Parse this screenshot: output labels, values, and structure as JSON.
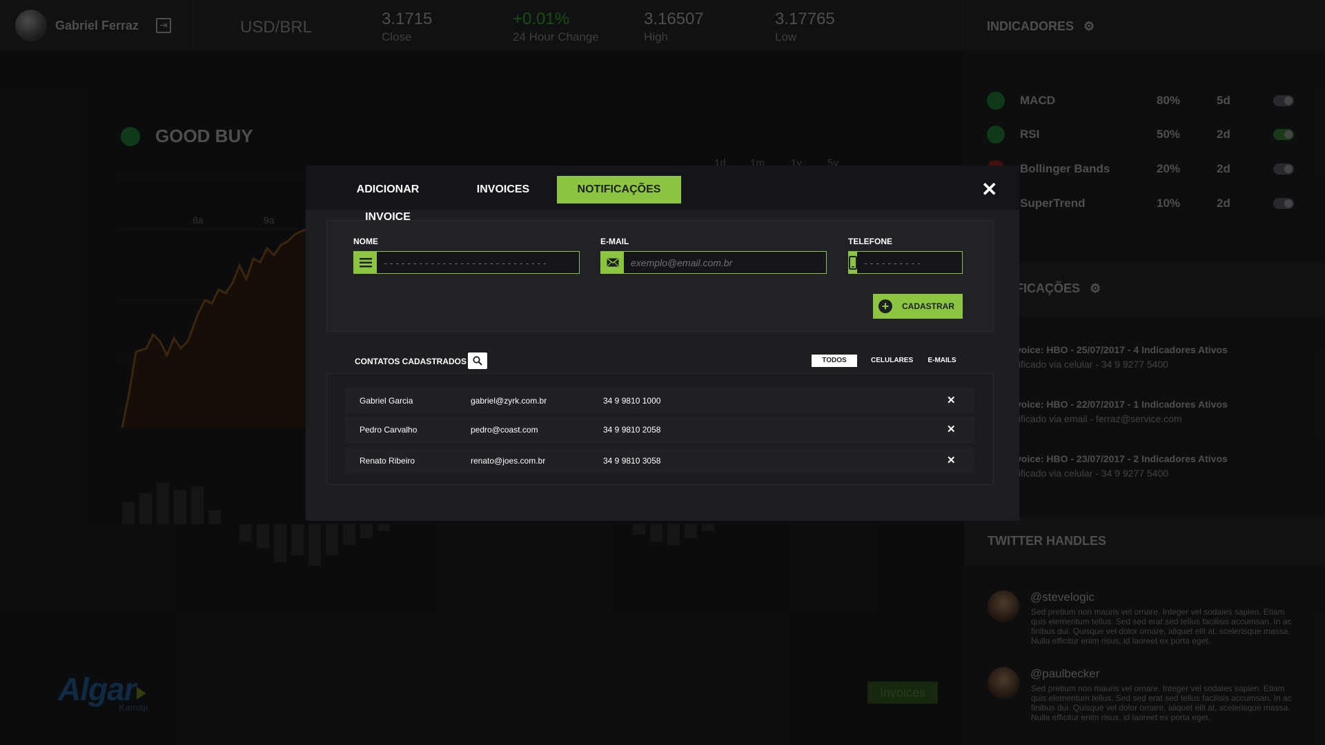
{
  "header": {
    "user_name": "Gabriel Ferraz",
    "pair": "USD/BRL",
    "stats": [
      {
        "value": "3.1715",
        "label": "Close"
      },
      {
        "value": "+0.01%",
        "label": "24 Hour Change"
      },
      {
        "value": "3.16507",
        "label": "High"
      },
      {
        "value": "3.17765",
        "label": "Low"
      }
    ],
    "indicators_title": "INDICADORES"
  },
  "indicators": [
    {
      "name": "MACD",
      "pct": "80%",
      "period": "5d",
      "on": false
    },
    {
      "name": "RSI",
      "pct": "50%",
      "period": "2d",
      "on": true
    },
    {
      "name": "Bollinger Bands",
      "pct": "20%",
      "period": "2d",
      "on": false
    },
    {
      "name": "SuperTrend",
      "pct": "10%",
      "period": "2d",
      "on": false
    }
  ],
  "notifications_panel": {
    "title": "FICAÇÕES",
    "items": [
      {
        "title": "voice: HBO - 25/07/2017 - 4 Indicadores Ativos",
        "sub": "tificado via celular - 34 9 9277 5400"
      },
      {
        "title": "voice: HBO - 22/07/2017 - 1 Indicadores Ativos",
        "sub": "tificado via email - ferraz@service.com"
      },
      {
        "title": "voice: HBO - 23/07/2017 - 2 Indicadores Ativos",
        "sub": "tificado via celular - 34 9 9277 5400"
      }
    ]
  },
  "twitter": {
    "title": "TWITTER HANDLES",
    "tweets": [
      {
        "handle": "@stevelogic",
        "text": "Sed pretium non mauris vel ornare. Integer vel sodales sapien. Etiam quis elementum tellus. Sed sed erat sed tellus facilisis accumsan. In ac finibus dui. Quisque vel dolor ornare, aliquet elit at, scelerisque massa. Nulla efficitur enim risus, id laoreet ex porta eget."
      },
      {
        "handle": "@paulbecker",
        "text": "Sed pretium non mauris vel ornare. Integer vel sodales sapien. Etiam quis elementum tellus. Sed sed erat sed tellus facilisis accumsan. In ac finibus dui. Quisque vel dolor ornare, aliquet elit at, scelerisque massa. Nulla efficitur enim risus, id laoreet ex porta eget."
      }
    ]
  },
  "main": {
    "signal": "GOOD BUY",
    "ranges": [
      "1d",
      "1m",
      "1y",
      "5y"
    ],
    "hours": [
      "8a",
      "9a"
    ],
    "brand": "Algar",
    "brand_sub": "Kamaji",
    "invoices_button": "Invoices"
  },
  "modal": {
    "tabs": [
      {
        "label": "ADICIONAR INVOICE",
        "active": false
      },
      {
        "label": "INVOICES",
        "active": false
      },
      {
        "label": "NOTIFICAÇÕES",
        "active": true
      }
    ],
    "close": "✕",
    "form": {
      "name_label": "NOME",
      "name_placeholder": "- - - - - - - - - - - - - - - - - - - - - - - - - - - -",
      "email_label": "E-MAIL",
      "email_placeholder": "exemplo@email.com.br",
      "phone_label": "TELEFONE",
      "phone_placeholder": "- - - - - - - - - -",
      "submit": "CADASTRAR"
    },
    "contacts": {
      "title": "CONTATOS CADASTRADOS",
      "filters": [
        {
          "label": "TODOS",
          "active": true
        },
        {
          "label": "CELULARES",
          "active": false
        },
        {
          "label": "E-MAILS",
          "active": false
        }
      ],
      "rows": [
        {
          "name": "Gabriel Garcia",
          "email": "gabriel@zyrk.com.br",
          "phone": "34 9 9810 1000"
        },
        {
          "name": "Pedro Carvalho",
          "email": "pedro@coast.com",
          "phone": "34 9 9810 2058"
        },
        {
          "name": "Renato Ribeiro",
          "email": "renato@joes.com.br",
          "phone": "34 9 9810 3058"
        }
      ],
      "remove_glyph": "✕"
    }
  },
  "colors": {
    "accent": "#8cc640",
    "positive": "#2e8f1f"
  }
}
